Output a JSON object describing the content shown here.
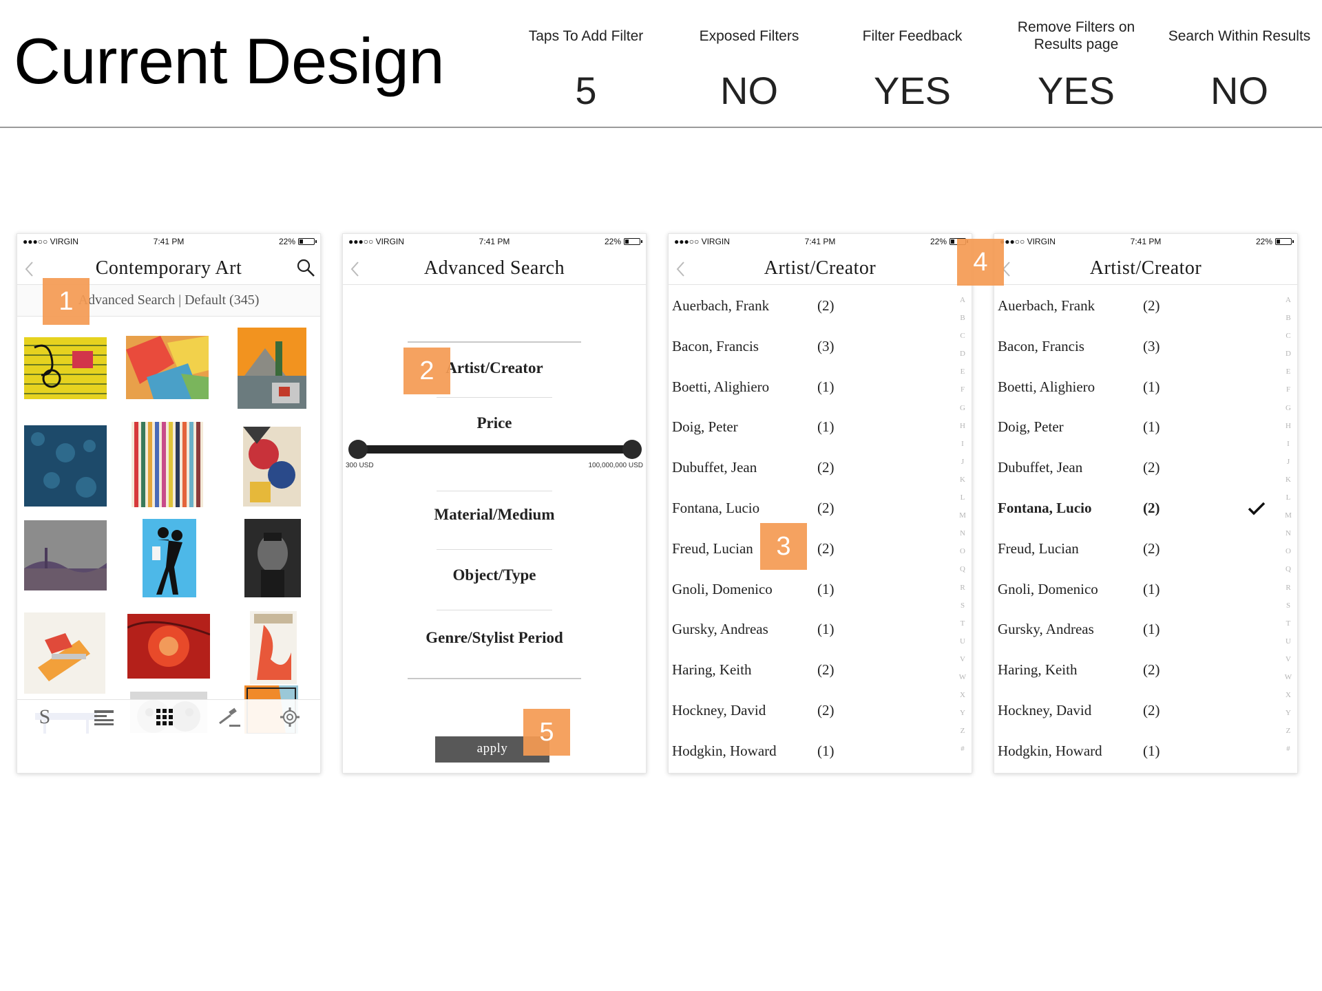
{
  "slide": {
    "title": "Current Design",
    "metrics": [
      {
        "label": "Taps To Add Filter",
        "value": "5"
      },
      {
        "label": "Exposed Filters",
        "value": "NO"
      },
      {
        "label": "Filter Feedback",
        "value": "YES"
      },
      {
        "label": "Remove Filters on Results page",
        "value": "YES"
      },
      {
        "label": "Search Within Results",
        "value": "NO"
      }
    ]
  },
  "status_bar": {
    "carrier": "●●●○○ VIRGIN",
    "time": "7:41 PM",
    "battery": "22%"
  },
  "screen1": {
    "title": "Contemporary Art",
    "subbar": "Advanced Search | Default  (345)",
    "tabs": [
      "search-tab",
      "list-view-tab",
      "grid-view-tab",
      "auction-tab",
      "settings-tab"
    ],
    "tab_s_label": "S"
  },
  "screen2": {
    "title": "Advanced Search",
    "items": [
      "Artist/Creator",
      "Price",
      "Material/Medium",
      "Object/Type",
      "Genre/Stylist Period"
    ],
    "price_min": "300 USD",
    "price_max": "100,000,000 USD",
    "apply_label": "apply"
  },
  "screen3": {
    "title": "Artist/Creator",
    "artists": [
      {
        "name": "Auerbach, Frank",
        "count": "(2)"
      },
      {
        "name": "Bacon, Francis",
        "count": "(3)"
      },
      {
        "name": "Boetti, Alighiero",
        "count": "(1)"
      },
      {
        "name": "Doig, Peter",
        "count": "(1)"
      },
      {
        "name": "Dubuffet, Jean",
        "count": "(2)"
      },
      {
        "name": "Fontana, Lucio",
        "count": "(2)"
      },
      {
        "name": "Freud, Lucian",
        "count": "(2)"
      },
      {
        "name": "Gnoli, Domenico",
        "count": "(1)"
      },
      {
        "name": "Gursky, Andreas",
        "count": "(1)"
      },
      {
        "name": "Haring, Keith",
        "count": "(2)"
      },
      {
        "name": "Hockney, David",
        "count": "(2)"
      },
      {
        "name": "Hodgkin, Howard",
        "count": "(1)"
      }
    ],
    "index_letters": [
      "A",
      "B",
      "C",
      "D",
      "E",
      "F",
      "G",
      "H",
      "I",
      "J",
      "K",
      "L",
      "M",
      "N",
      "O",
      "Q",
      "R",
      "S",
      "T",
      "U",
      "V",
      "W",
      "X",
      "Y",
      "Z",
      "#"
    ]
  },
  "screen4": {
    "title": "Artist/Creator",
    "selected_artist": "Fontana, Lucio"
  },
  "markers": [
    "1",
    "2",
    "3",
    "4",
    "5"
  ],
  "colors": {
    "marker": "#f49a52",
    "apply_button": "#585858",
    "text": "#222222"
  }
}
